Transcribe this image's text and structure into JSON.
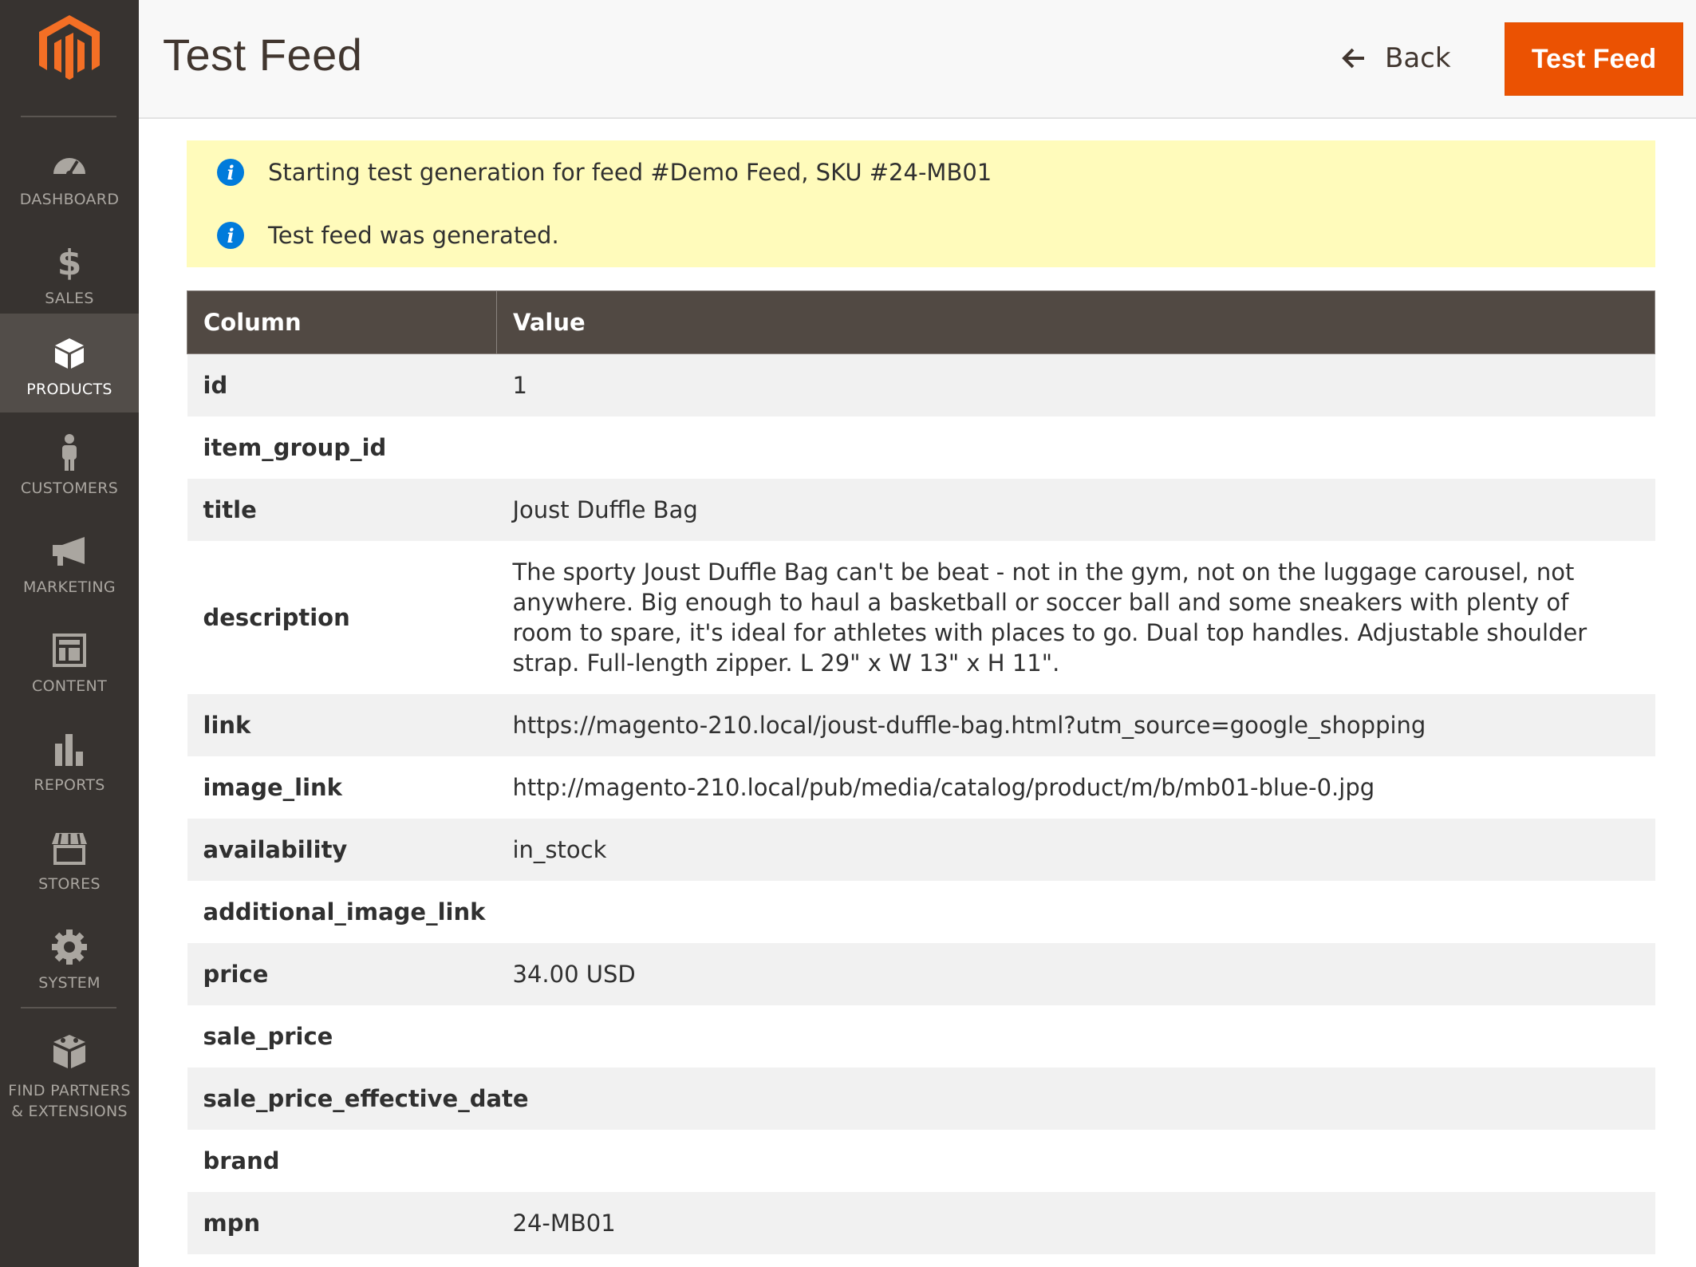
{
  "sidebar": {
    "logo_icon": "magento-logo-icon",
    "items": [
      {
        "label": "DASHBOARD",
        "icon": "speedometer-icon"
      },
      {
        "label": "SALES",
        "icon": "dollar-icon"
      },
      {
        "label": "PRODUCTS",
        "icon": "cube-icon",
        "active": true
      },
      {
        "label": "CUSTOMERS",
        "icon": "person-icon"
      },
      {
        "label": "MARKETING",
        "icon": "megaphone-icon"
      },
      {
        "label": "CONTENT",
        "icon": "layout-icon"
      },
      {
        "label": "REPORTS",
        "icon": "bar-chart-icon"
      },
      {
        "label": "STORES",
        "icon": "storefront-icon"
      },
      {
        "label": "SYSTEM",
        "icon": "gear-icon"
      },
      {
        "label_line1": "FIND PARTNERS",
        "label_line2": "& EXTENSIONS",
        "icon": "blocks-icon"
      }
    ]
  },
  "header": {
    "title": "Test Feed",
    "back_label": "Back",
    "primary_label": "Test Feed"
  },
  "messages": [
    "Starting test generation for feed #Demo Feed, SKU #24-MB01",
    "Test feed was generated."
  ],
  "table": {
    "columns": [
      "Column",
      "Value"
    ],
    "rows": [
      {
        "key": "id",
        "value": "1"
      },
      {
        "key": "item_group_id",
        "value": ""
      },
      {
        "key": "title",
        "value": "Joust Duffle Bag"
      },
      {
        "key": "description",
        "value": "The sporty Joust Duffle Bag can't be beat - not in the gym, not on the luggage carousel, not anywhere. Big enough to haul a basketball or soccer ball and some sneakers with plenty of room to spare, it's ideal for athletes with places to go. Dual top handles. Adjustable shoulder strap. Full-length zipper. L 29\" x W 13\" x H 11\"."
      },
      {
        "key": "link",
        "value": "https://magento-210.local/joust-duffle-bag.html?utm_source=google_shopping"
      },
      {
        "key": "image_link",
        "value": "http://magento-210.local/pub/media/catalog/product/m/b/mb01-blue-0.jpg"
      },
      {
        "key": "availability",
        "value": "in_stock"
      },
      {
        "key": "additional_image_link",
        "value": ""
      },
      {
        "key": "price",
        "value": "34.00 USD"
      },
      {
        "key": "sale_price",
        "value": ""
      },
      {
        "key": "sale_price_effective_date",
        "value": ""
      },
      {
        "key": "brand",
        "value": ""
      },
      {
        "key": "mpn",
        "value": "24-MB01"
      }
    ]
  },
  "colors": {
    "sidebar_bg": "#373330",
    "sidebar_active_bg": "#524d49",
    "accent": "#eb5202",
    "message_bg": "#fffbbb",
    "table_header_bg": "#514943",
    "info_blue": "#007bdb"
  }
}
